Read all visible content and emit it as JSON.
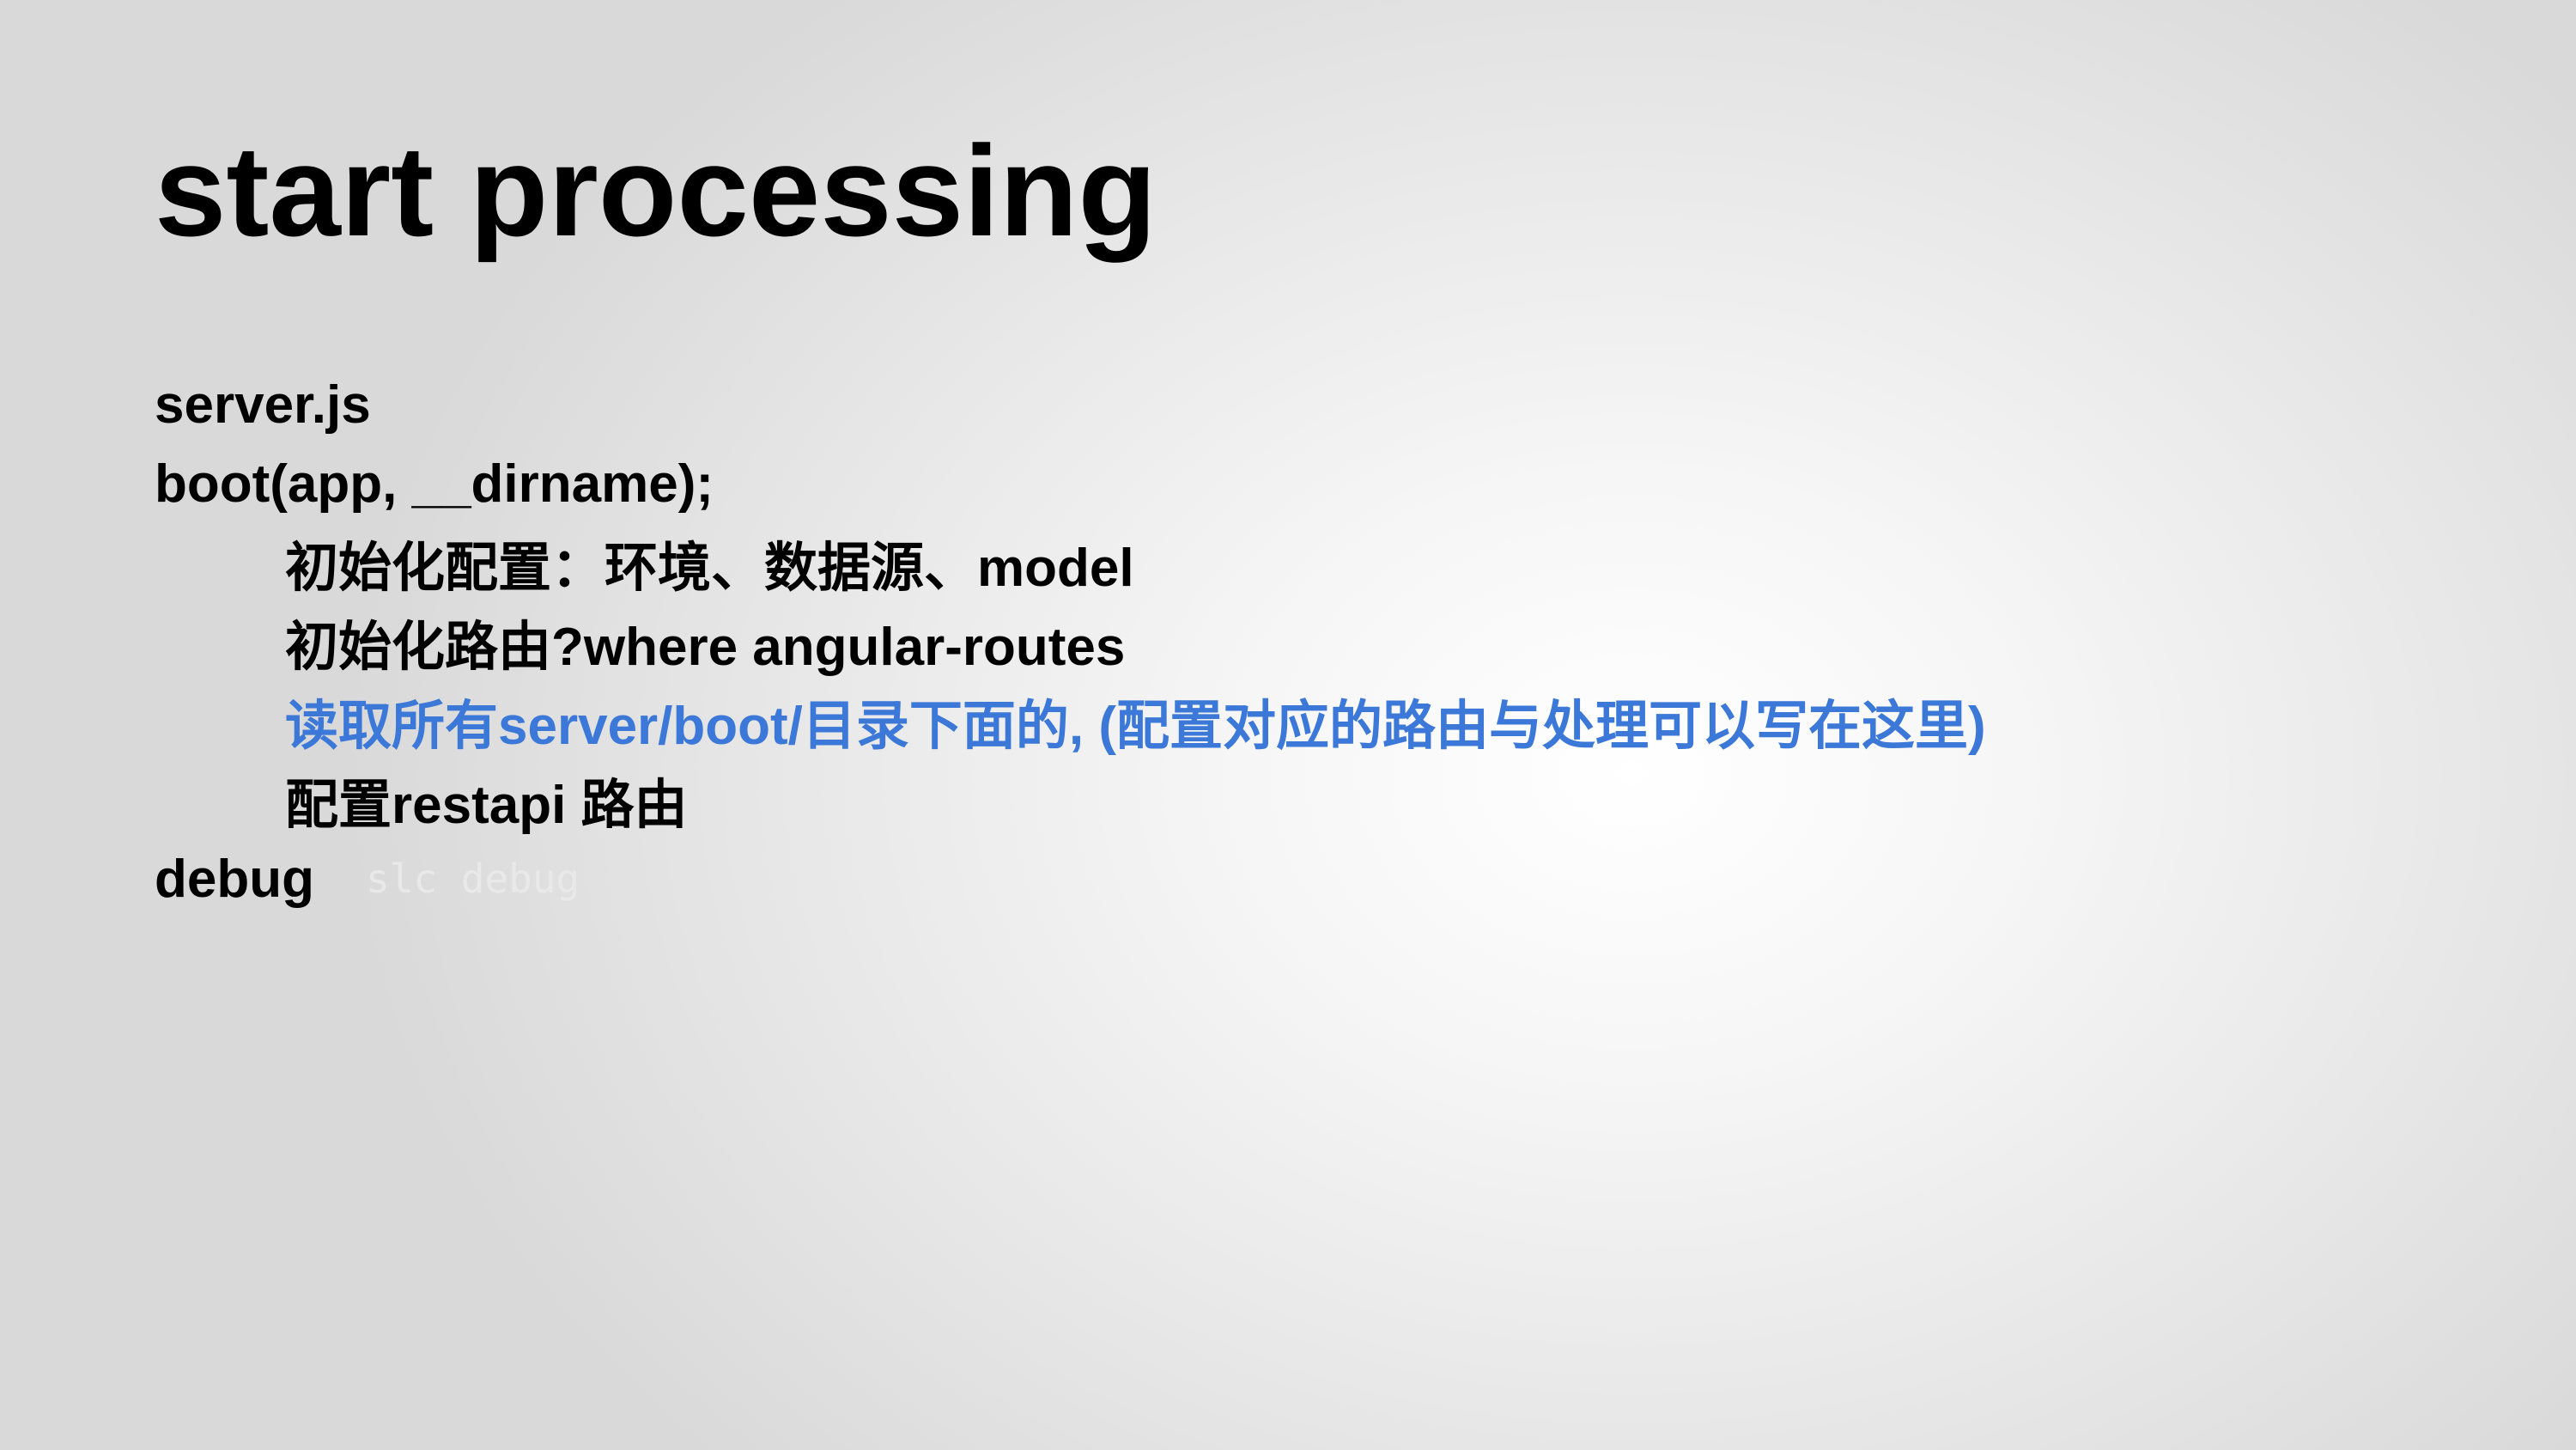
{
  "slide": {
    "title": "start processing",
    "lines": [
      "server.js",
      "boot(app, __dirname);",
      "初始化配置：环境、数据源、model",
      "初始化路由?where angular-routes",
      "读取所有server/boot/目录下面的, (配置对应的路由与处理可以写在这里)",
      "配置restapi 路由"
    ],
    "debug_label": "debug",
    "debug_command": "slc debug",
    "accent_color": "#3c78d8"
  }
}
